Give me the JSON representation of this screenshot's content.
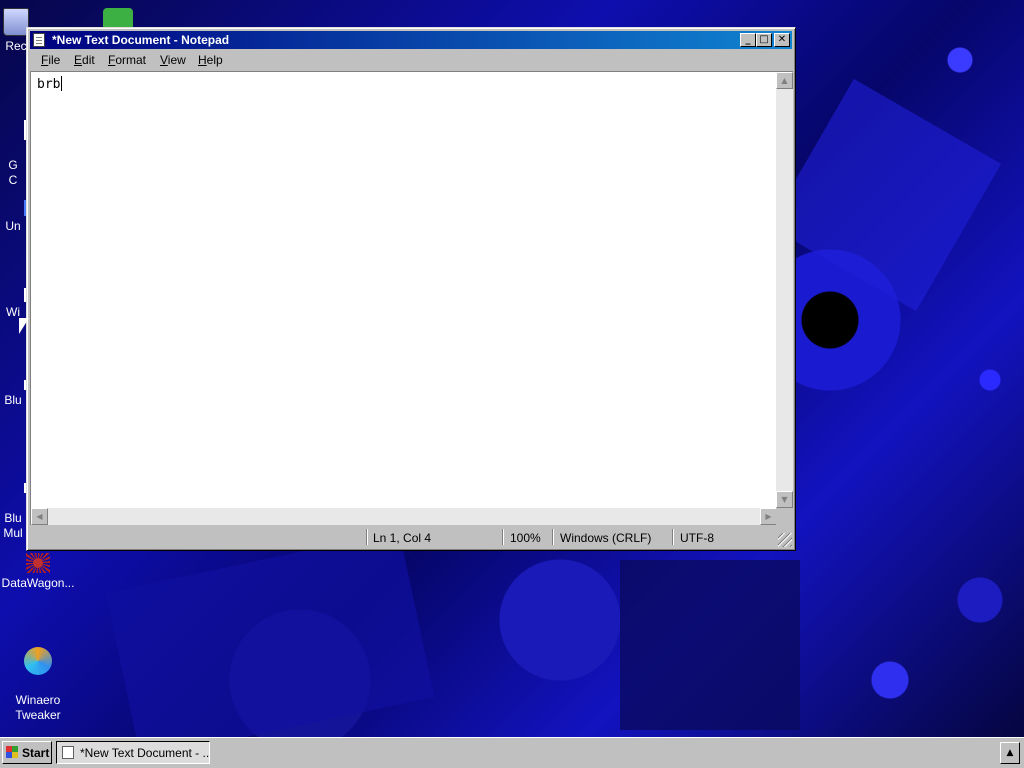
{
  "desktop": {
    "icons": [
      {
        "name": "recycle-bin",
        "label": "Rec"
      },
      {
        "name": "green-app",
        "label": ""
      },
      {
        "name": "g-shortcut",
        "label": "G\nC"
      },
      {
        "name": "un-shortcut",
        "label": "Un"
      },
      {
        "name": "wi-shortcut",
        "label": "Wi"
      },
      {
        "name": "blu-shortcut",
        "label": "Blu"
      },
      {
        "name": "blu-mul-shortcut",
        "label": "Blu\nMul"
      },
      {
        "name": "datawagon",
        "label": "DataWagon..."
      },
      {
        "name": "winaero-tweaker",
        "label": "Winaero\nTweaker"
      }
    ],
    "wallpaper_color": "#0a0a6e"
  },
  "window": {
    "title": "*New Text Document - Notepad",
    "controls": {
      "minimize": "_",
      "maximize": "□",
      "close": "✕"
    },
    "menu": [
      {
        "underline": "F",
        "rest": "ile"
      },
      {
        "underline": "E",
        "rest": "dit"
      },
      {
        "underline": "F",
        "rest": "ormat"
      },
      {
        "underline": "V",
        "rest": "iew"
      },
      {
        "underline": "H",
        "rest": "elp"
      }
    ],
    "content": "brb",
    "status": {
      "position": "Ln 1, Col 4",
      "zoom": "100%",
      "line_ending": "Windows (CRLF)",
      "encoding": "UTF-8"
    },
    "title_gradient": [
      "#000080",
      "#1084d0"
    ]
  },
  "taskbar": {
    "start_label": "Start",
    "task_label": "*New Text Document - ...",
    "tray_arrow": "▲"
  }
}
